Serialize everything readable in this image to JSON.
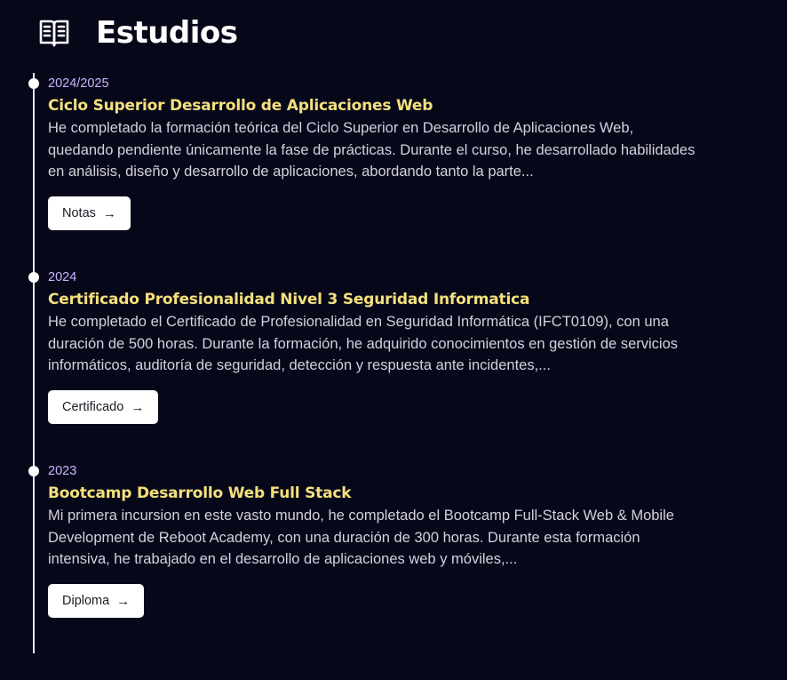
{
  "section": {
    "title": "Estudios",
    "icon": "open-book-icon"
  },
  "entries": [
    {
      "year": "2024/2025",
      "title": "Ciclo Superior Desarrollo de Aplicaciones Web",
      "description": "He completado la formación teórica del Ciclo Superior en Desarrollo de Aplicaciones Web, quedando pendiente únicamente la fase de prácticas. Durante el curso, he desarrollado habilidades en análisis, diseño y desarrollo de aplicaciones, abordando tanto la parte...",
      "button_label": "Notas",
      "button_icon": "arrow-right-icon"
    },
    {
      "year": "2024",
      "title": "Certificado Profesionalidad Nivel 3 Seguridad Informatica",
      "description": "He completado el Certificado de Profesionalidad en Seguridad Informática (IFCT0109), con una duración de 500 horas. Durante la formación, he adquirido conocimientos en gestión de servicios informáticos, auditoría de seguridad, detección y respuesta ante incidentes,...",
      "button_label": "Certificado",
      "button_icon": "arrow-right-icon"
    },
    {
      "year": "2023",
      "title": "Bootcamp Desarrollo Web Full Stack",
      "description": "Mi primera incursion en este vasto mundo, he completado el Bootcamp Full-Stack Web & Mobile Development de Reboot Academy, con una duración de 300 horas. Durante esta formación intensiva, he trabajado en el desarrollo de aplicaciones web y móviles,...",
      "button_label": "Diploma",
      "button_icon": "arrow-right-icon"
    }
  ],
  "colors": {
    "background": "#07071a",
    "year": "#c8b6ff",
    "title": "#f4e07c",
    "text": "#d2d2dc"
  }
}
